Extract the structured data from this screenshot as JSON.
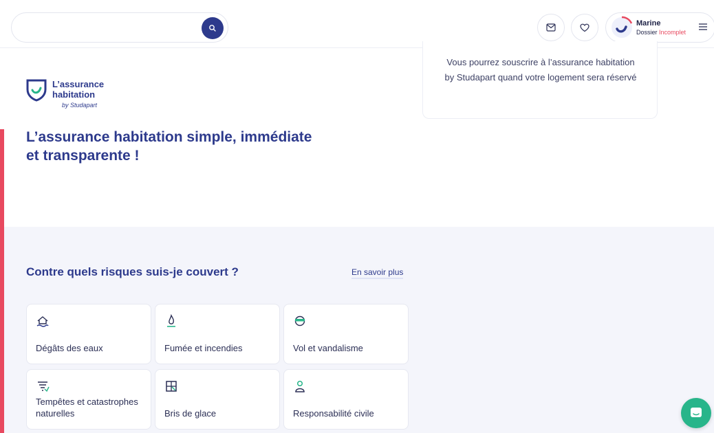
{
  "header": {
    "search": {
      "placeholder": "",
      "icon": "search-icon"
    },
    "mail_icon": "mail-icon",
    "favorites_icon": "heart-icon",
    "user": {
      "name": "Marine",
      "status_prefix": "Dossier",
      "status_value": "Incomplet",
      "menu_icon": "hamburger-menu-icon"
    }
  },
  "logo": {
    "title": "L’assurance habitation",
    "subtitle": "by Studapart"
  },
  "hero": {
    "title": "L’assurance habitation simple, immédiate et transparente !"
  },
  "info_card": {
    "text": "Vous pourrez souscrire à l’assurance habitation by Studapart quand votre logement sera réservé"
  },
  "risks": {
    "title": "Contre quels risques suis-je couvert ?",
    "learn_more": "En savoir plus",
    "items": [
      {
        "label": "Dégâts des eaux",
        "icon": "water-damage-icon"
      },
      {
        "label": "Fumée et incendies",
        "icon": "fire-icon"
      },
      {
        "label": "Vol et vandalisme",
        "icon": "theft-icon"
      },
      {
        "label": "Tempêtes et catastrophes naturelles",
        "icon": "storm-icon"
      },
      {
        "label": "Bris de glace",
        "icon": "broken-glass-icon"
      },
      {
        "label": "Responsabilité civile",
        "icon": "civil-liability-icon"
      }
    ]
  },
  "chat": {
    "icon": "chat-icon"
  },
  "colors": {
    "brand": "#2d3a8c",
    "accent": "#e8495f",
    "success": "#28b58a",
    "background": "#f4f5fb"
  }
}
